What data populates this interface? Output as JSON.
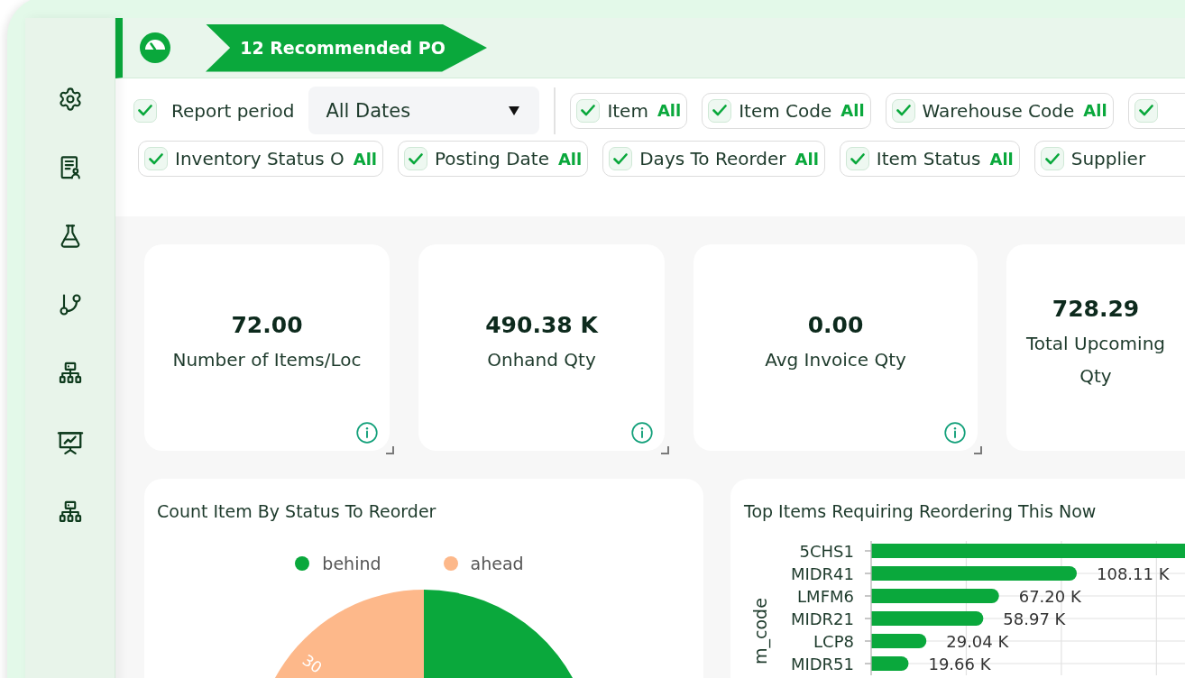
{
  "top_bar": {
    "banner": "12 Recommended PO"
  },
  "filters": {
    "report_period": {
      "checked": true,
      "label": "Report period",
      "value": "All Dates"
    },
    "chip_rows": [
      [
        {
          "checked": true,
          "label": "Item",
          "value": "All"
        },
        {
          "checked": true,
          "label": "Item Code",
          "value": "All"
        },
        {
          "checked": true,
          "label": "Warehouse Code",
          "value": "All"
        },
        {
          "checked": true
        }
      ],
      [
        {
          "checked": true,
          "label": "Inventory Status O",
          "value": "All"
        },
        {
          "checked": true,
          "label": "Posting Date",
          "value": "All"
        },
        {
          "checked": true,
          "label": "Days To Reorder",
          "value": "All"
        },
        {
          "checked": true,
          "label": "Item Status",
          "value": "All"
        },
        {
          "checked": true,
          "label": "Supplier"
        }
      ]
    ]
  },
  "kpi_cards": [
    {
      "value": "72.00",
      "label": "Number of Items/Loc",
      "info": true
    },
    {
      "value": "490.38 K",
      "label": "Onhand Qty",
      "info": true
    },
    {
      "value": "0.00",
      "label": "Avg Invoice Qty",
      "info": true
    },
    {
      "value": "728.29",
      "label": "Total Upcoming\nQty",
      "info": false
    }
  ],
  "status_chart": {
    "title": "Count Item By Status To Reorder",
    "legend": [
      {
        "label": "behind",
        "color": "#0aa83c"
      },
      {
        "label": "ahead",
        "color": "#fdb88a"
      }
    ],
    "slice_label": "30"
  },
  "top_items_chart": {
    "title": "Top Items Requiring Reordering This Now",
    "chart_data": {
      "type": "bar",
      "orientation": "horizontal",
      "ylabel": "m_code",
      "categories": [
        "5CHS1",
        "MIDR41",
        "LMFM6",
        "MIDR21",
        "LCP8",
        "MIDR51"
      ],
      "values": [
        165000,
        108110,
        67200,
        58970,
        29040,
        19660
      ],
      "value_labels": [
        null,
        "108.11 K",
        "67.20 K",
        "58.97 K",
        "29.04 K",
        "19.66 K"
      ],
      "xlim": [
        0,
        165000
      ]
    }
  }
}
